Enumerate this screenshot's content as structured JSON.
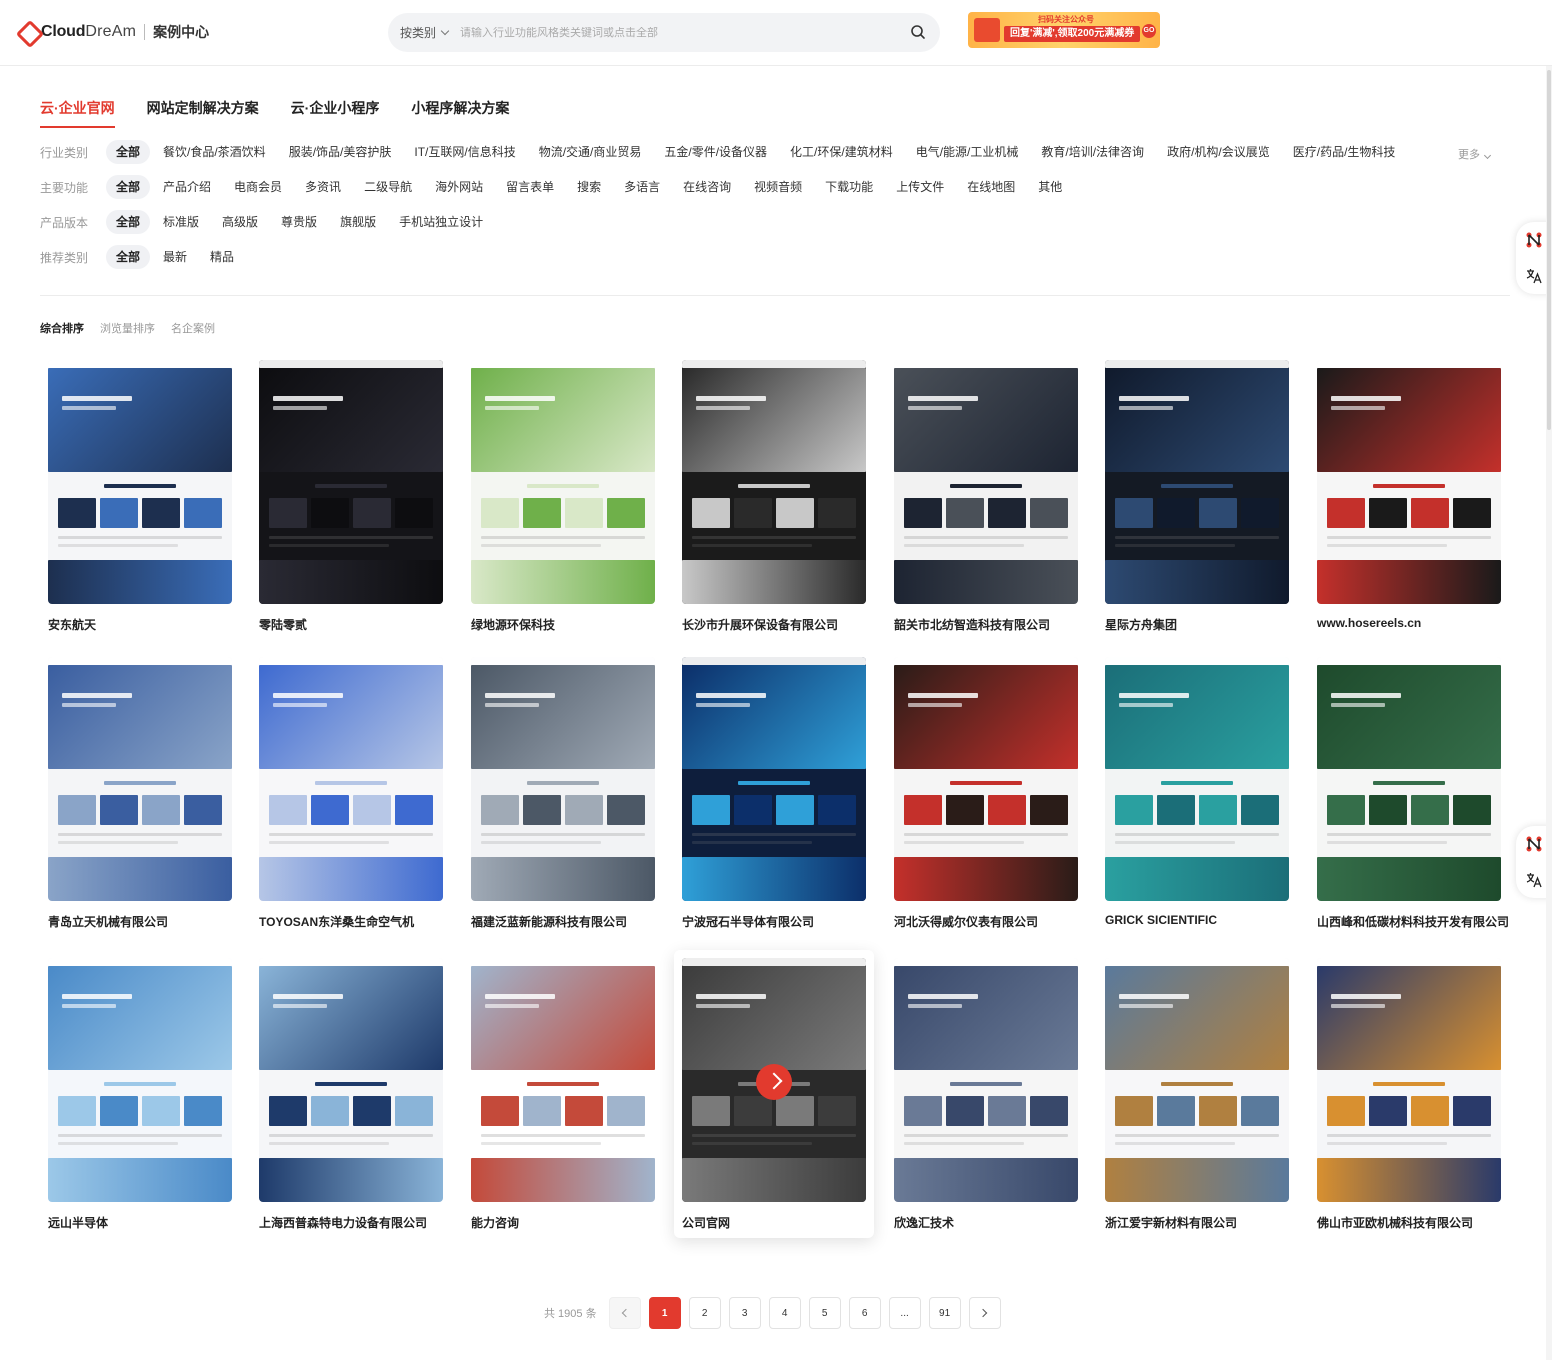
{
  "header": {
    "logo_brand": "CloudDream",
    "logo_brand_a": "Cloud",
    "logo_brand_b": "DreAm",
    "logo_sub": "案例中心",
    "search_category": "按类别",
    "search_placeholder": "请输入行业功能风格类关键词或点击全部",
    "promo_top": "扫码关注公众号",
    "promo_text": "回复'满减',领取200元满减券",
    "promo_go": "GO"
  },
  "tabs": [
    {
      "label": "云·企业官网",
      "active": true
    },
    {
      "label": "网站定制解决方案",
      "active": false
    },
    {
      "label": "云·企业小程序",
      "active": false
    },
    {
      "label": "小程序解决方案",
      "active": false
    }
  ],
  "filters": [
    {
      "label": "行业类别",
      "options": [
        "全部",
        "餐饮/食品/茶酒饮料",
        "服装/饰品/美容护肤",
        "IT/互联网/信息科技",
        "物流/交通/商业贸易",
        "五金/零件/设备仪器",
        "化工/环保/建筑材料",
        "电气/能源/工业机械",
        "教育/培训/法律咨询",
        "政府/机构/会议展览",
        "医疗/药品/生物科技"
      ]
    },
    {
      "label": "主要功能",
      "options": [
        "全部",
        "产品介绍",
        "电商会员",
        "多资讯",
        "二级导航",
        "海外网站",
        "留言表单",
        "搜索",
        "多语言",
        "在线咨询",
        "视频音频",
        "下载功能",
        "上传文件",
        "在线地图",
        "其他"
      ]
    },
    {
      "label": "产品版本",
      "options": [
        "全部",
        "标准版",
        "高级版",
        "尊贵版",
        "旗舰版",
        "手机站独立设计"
      ]
    },
    {
      "label": "推荐类别",
      "options": [
        "全部",
        "最新",
        "精品"
      ]
    }
  ],
  "more_label": "更多",
  "sort": [
    "综合排序",
    "浏览量排序",
    "名企案例"
  ],
  "cases": [
    {
      "name": "安东航天"
    },
    {
      "name": "零陆零贰"
    },
    {
      "name": "绿地源环保科技"
    },
    {
      "name": "长沙市升展环保设备有限公司"
    },
    {
      "name": "韶关市北纺智造科技有限公司"
    },
    {
      "name": "星际方舟集团"
    },
    {
      "name": "www.hosereels.cn"
    },
    {
      "name": "青岛立天机械有限公司"
    },
    {
      "name": "TOYOSAN东洋桑生命空气机"
    },
    {
      "name": "福建泛蓝新能源科技有限公司"
    },
    {
      "name": "宁波冠石半导体有限公司"
    },
    {
      "name": "河北沃得威尔仪表有限公司"
    },
    {
      "name": "GRICK SICIENTIFIC"
    },
    {
      "name": "山西峰和低碳材料科技开发有限公司"
    },
    {
      "name": "远山半导体"
    },
    {
      "name": "上海西普森特电力设备有限公司"
    },
    {
      "name": "能力咨询"
    },
    {
      "name": "公司官网"
    },
    {
      "name": "欣逸汇技术"
    },
    {
      "name": "浙江爱宇新材料有限公司"
    },
    {
      "name": "佛山市亚欧机械科技有限公司"
    }
  ],
  "pagination": {
    "total_text": "共 1905 条",
    "pages": [
      "1",
      "2",
      "3",
      "4",
      "5",
      "6",
      "...",
      "91"
    ],
    "current": "1"
  },
  "colors": {
    "accent": "#e23a2e"
  }
}
